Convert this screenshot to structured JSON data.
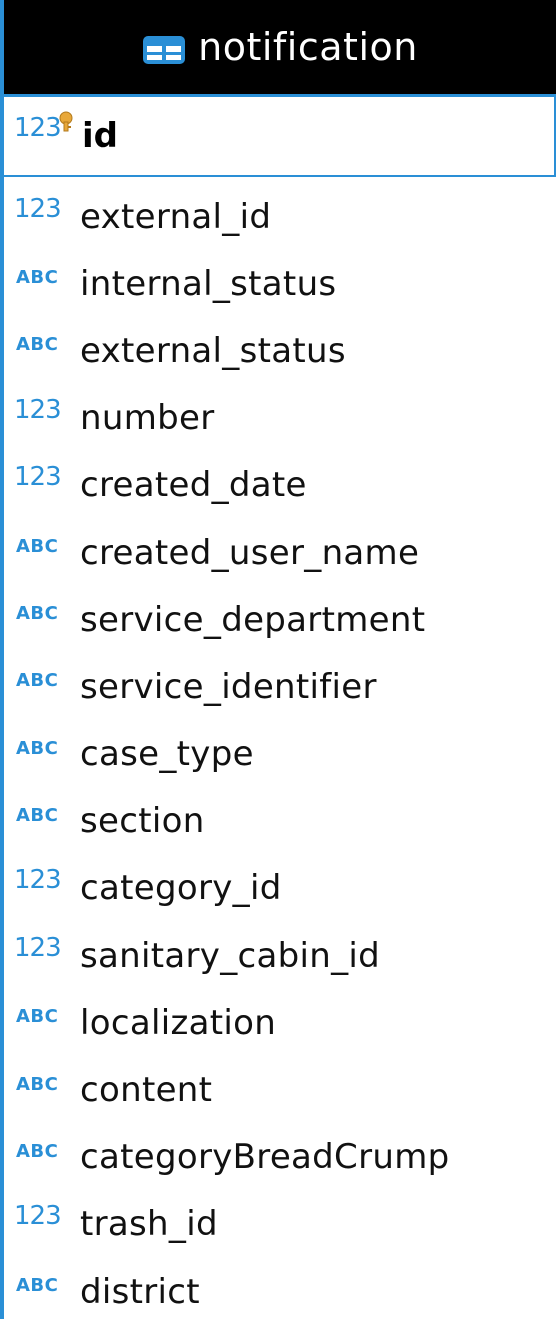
{
  "entity": {
    "name": "notification",
    "primary_key": {
      "type": "123",
      "name": "id"
    },
    "columns": [
      {
        "type": "123",
        "name": "external_id"
      },
      {
        "type": "ABC",
        "name": "internal_status"
      },
      {
        "type": "ABC",
        "name": "external_status"
      },
      {
        "type": "123",
        "name": "number"
      },
      {
        "type": "123",
        "name": "created_date"
      },
      {
        "type": "ABC",
        "name": "created_user_name"
      },
      {
        "type": "ABC",
        "name": "service_department"
      },
      {
        "type": "ABC",
        "name": "service_identifier"
      },
      {
        "type": "ABC",
        "name": "case_type"
      },
      {
        "type": "ABC",
        "name": "section"
      },
      {
        "type": "123",
        "name": "category_id"
      },
      {
        "type": "123",
        "name": "sanitary_cabin_id"
      },
      {
        "type": "ABC",
        "name": "localization"
      },
      {
        "type": "ABC",
        "name": "content"
      },
      {
        "type": "ABC",
        "name": "categoryBreadCrump"
      },
      {
        "type": "123",
        "name": "trash_id"
      },
      {
        "type": "ABC",
        "name": "district"
      }
    ]
  },
  "colors": {
    "header_bg": "#000000",
    "header_text": "#ffffff",
    "accent": "#2a8fd6",
    "key_icon": "#e8a83a"
  },
  "icons": {
    "header": "table-icon",
    "primary_key": "key-icon",
    "numeric_type": "numeric-type-icon",
    "string_type": "string-type-icon"
  }
}
